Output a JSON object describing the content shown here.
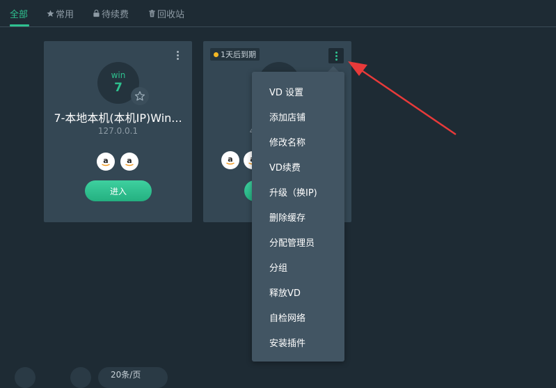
{
  "tabs": [
    {
      "label": "全部",
      "icon": ""
    },
    {
      "label": "常用",
      "icon": "star-icon"
    },
    {
      "label": "待续费",
      "icon": "bag-icon"
    },
    {
      "label": "回收站",
      "icon": "trash-icon"
    }
  ],
  "cards": [
    {
      "os": "win",
      "version": "7",
      "title": "7-本地本机(本机IP)Win...",
      "ip": "127.0.0.1",
      "shops": [
        "amazon-icon",
        "amazon-icon"
      ],
      "enter_label": "进入"
    },
    {
      "expire_label": "1天后到期",
      "ip_partial": "4",
      "shops": [
        "amazon-icon",
        "amazon-icon"
      ]
    }
  ],
  "menu": {
    "items": [
      "VD 设置",
      "添加店铺",
      "修改名称",
      "VD续费",
      "升级（换IP)",
      "删除缓存",
      "分配管理员",
      "分组",
      "释放VD",
      "自检网络",
      "安装插件"
    ]
  },
  "pager": {
    "size_label": "20条/页"
  },
  "colors": {
    "accent": "#2ec18f",
    "background": "#1e2b34",
    "card": "#344754",
    "menu": "#425563",
    "warning": "#f3b723",
    "annotation": "#e83a3a"
  }
}
